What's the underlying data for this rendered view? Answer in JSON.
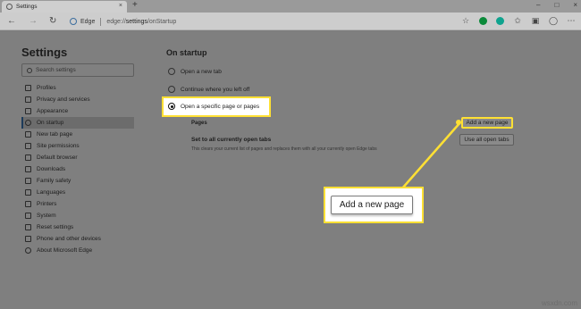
{
  "browser": {
    "tab_title": "Settings",
    "tab_close": "×",
    "new_tab": "+",
    "brand": "Edge",
    "url_prefix": "edge://",
    "url_path": "settings",
    "url_suffix": "/onStartup",
    "window_controls": [
      "–",
      "□",
      "×"
    ]
  },
  "sidebar": {
    "title": "Settings",
    "search_placeholder": "Search settings",
    "items": [
      {
        "label": "Profiles",
        "icon": "profile-icon"
      },
      {
        "label": "Privacy and services",
        "icon": "lock-icon"
      },
      {
        "label": "Appearance",
        "icon": "appearance-icon"
      },
      {
        "label": "On startup",
        "icon": "power-icon",
        "active": true
      },
      {
        "label": "New tab page",
        "icon": "newtab-icon"
      },
      {
        "label": "Site permissions",
        "icon": "permissions-icon"
      },
      {
        "label": "Default browser",
        "icon": "browser-icon"
      },
      {
        "label": "Downloads",
        "icon": "download-icon"
      },
      {
        "label": "Family safety",
        "icon": "family-icon"
      },
      {
        "label": "Languages",
        "icon": "language-icon"
      },
      {
        "label": "Printers",
        "icon": "printer-icon"
      },
      {
        "label": "System",
        "icon": "system-icon"
      },
      {
        "label": "Reset settings",
        "icon": "reset-icon"
      },
      {
        "label": "Phone and other devices",
        "icon": "phone-icon"
      },
      {
        "label": "About Microsoft Edge",
        "icon": "edge-icon"
      }
    ]
  },
  "main": {
    "title": "On startup",
    "options": [
      {
        "label": "Open a new tab",
        "checked": false
      },
      {
        "label": "Continue where you left off",
        "checked": false
      },
      {
        "label": "Open a specific page or pages",
        "checked": true
      }
    ],
    "pages_label": "Pages",
    "add_page_label": "Add a new page",
    "set_all_title": "Set to all currently open tabs",
    "set_all_desc": "This clears your current list of pages and replaces them with all your currently open Edge tabs",
    "use_all_label": "Use all open tabs"
  },
  "callout": {
    "label": "Add a new page",
    "accent": "#ffe034"
  },
  "watermark": "wsxdn.com"
}
